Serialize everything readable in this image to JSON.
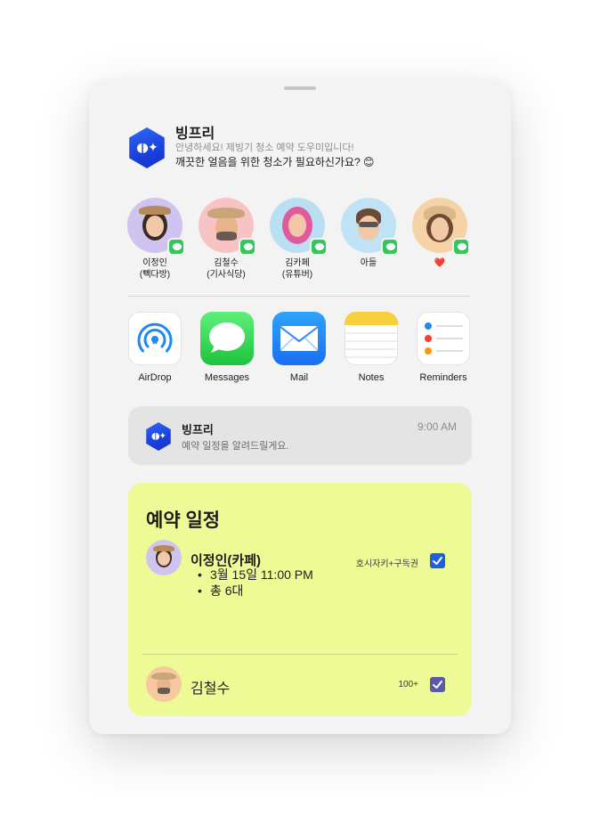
{
  "header": {
    "app_name": "빙프리",
    "subtitle": "안녕하세요! 제빙기 청소 예약 도우미입니다!",
    "message": "깨끗한 얼음을 위한 청소가 필요하신가요? 😊",
    "icon": "sparkle-hexagon-icon",
    "icon_glyph": "◖◗✦",
    "brand_color": "#1f47e0"
  },
  "contacts": [
    {
      "name": "이정인",
      "sub": "(빽다방)",
      "avatar_bg": "#cfc3ef"
    },
    {
      "name": "김철수",
      "sub": "(기사식당)",
      "avatar_bg": "#f7c3c4"
    },
    {
      "name": "김카페",
      "sub": "(유튜버)",
      "avatar_bg": "#b9e0f2"
    },
    {
      "name": "아들",
      "sub": "",
      "avatar_bg": "#bfe3f4"
    },
    {
      "name": "❤️",
      "sub": "",
      "avatar_bg": "#f6d3a6"
    }
  ],
  "apps": [
    {
      "label": "AirDrop",
      "icon": "airdrop-icon"
    },
    {
      "label": "Messages",
      "icon": "messages-icon"
    },
    {
      "label": "Mail",
      "icon": "mail-icon"
    },
    {
      "label": "Notes",
      "icon": "notes-icon"
    },
    {
      "label": "Reminders",
      "icon": "reminders-icon"
    }
  ],
  "notification": {
    "title": "빙프리",
    "body": "예약 일정을 알려드릴게요.",
    "time": "9:00 AM"
  },
  "schedule": {
    "title": "예약 일정",
    "row1": {
      "name": "이정인(카페)",
      "details": [
        "3월 15일 11:00 PM",
        "총 6대"
      ],
      "tag": "호시자키+구독권",
      "checked": true,
      "check_color": "#1f5fe0"
    },
    "row2": {
      "name": "김철수",
      "tag": "100+",
      "checked": true,
      "check_color": "#5b5aa8"
    },
    "card_color": "#eefa95"
  }
}
